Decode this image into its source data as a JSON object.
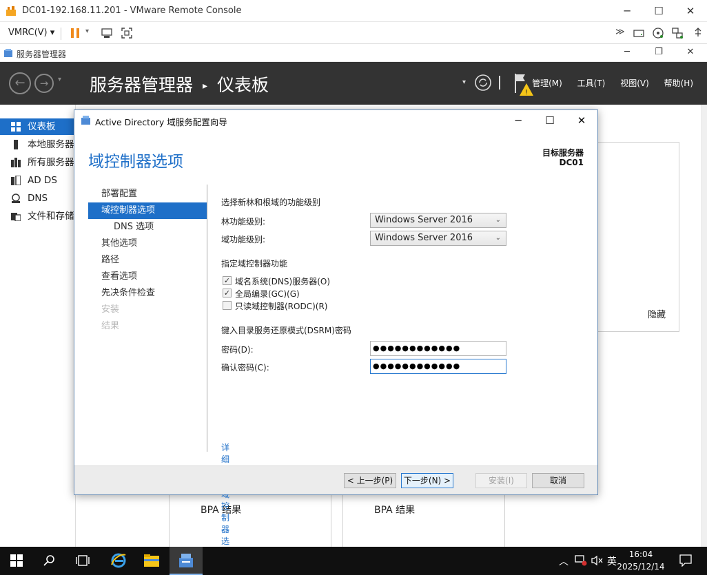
{
  "vmrc": {
    "window_title": "DC01-192.168.11.201 - VMware Remote Console",
    "menu_label": "VMRC(V)"
  },
  "server_manager": {
    "window_title": "服务器管理器",
    "breadcrumb_root": "服务器管理器",
    "breadcrumb_separator": "▸",
    "breadcrumb_page": "仪表板",
    "menus": [
      "管理(M)",
      "工具(T)",
      "视图(V)",
      "帮助(H)"
    ],
    "sidebar": [
      {
        "label": "仪表板",
        "icon": "dashboard-icon",
        "active": true
      },
      {
        "label": "本地服务器",
        "icon": "local-server-icon",
        "active": false
      },
      {
        "label": "所有服务器",
        "icon": "all-servers-icon",
        "active": false
      },
      {
        "label": "AD DS",
        "icon": "adds-icon",
        "active": false
      },
      {
        "label": "DNS",
        "icon": "dns-icon",
        "active": false
      },
      {
        "label": "文件和存储",
        "icon": "file-storage-icon",
        "active": false
      }
    ],
    "hide_label": "隐藏",
    "bpa_labels": [
      "BPA 结果",
      "BPA 结果"
    ]
  },
  "dialog": {
    "title": "Active Directory 域服务配置向导",
    "heading": "域控制器选项",
    "target_label": "目标服务器",
    "target_name": "DC01",
    "steps": [
      {
        "label": "部署配置",
        "state": "normal"
      },
      {
        "label": "域控制器选项",
        "state": "active"
      },
      {
        "label": "DNS 选项",
        "state": "sub"
      },
      {
        "label": "其他选项",
        "state": "normal"
      },
      {
        "label": "路径",
        "state": "normal"
      },
      {
        "label": "查看选项",
        "state": "normal"
      },
      {
        "label": "先决条件检查",
        "state": "normal"
      },
      {
        "label": "安装",
        "state": "disabled"
      },
      {
        "label": "结果",
        "state": "disabled"
      }
    ],
    "functional_level_title": "选择新林和根域的功能级别",
    "forest_level_label": "林功能级别:",
    "forest_level_value": "Windows Server 2016",
    "domain_level_label": "域功能级别:",
    "domain_level_value": "Windows Server 2016",
    "capabilities_title": "指定域控制器功能",
    "capabilities": [
      {
        "label": "域名系统(DNS)服务器(O)",
        "checked": true
      },
      {
        "label": "全局编录(GC)(G)",
        "checked": true
      },
      {
        "label": "只读域控制器(RODC)(R)",
        "checked": false
      }
    ],
    "dsrm_title": "键入目录服务还原模式(DSRM)密码",
    "password_label": "密码(D):",
    "password_value": "●●●●●●●●●●●●",
    "confirm_label": "确认密码(C):",
    "confirm_value": "●●●●●●●●●●●●",
    "more_link": "详细了解 域控制器选项",
    "buttons": {
      "back": "< 上一步(P)",
      "next": "下一步(N) >",
      "install": "安装(I)",
      "cancel": "取消"
    }
  },
  "taskbar": {
    "time": "16:04",
    "date": "2025/12/14",
    "ime": "英"
  },
  "colors": {
    "accent": "#1e6fc8",
    "header_bg": "#333333",
    "taskbar_bg": "#101010"
  }
}
